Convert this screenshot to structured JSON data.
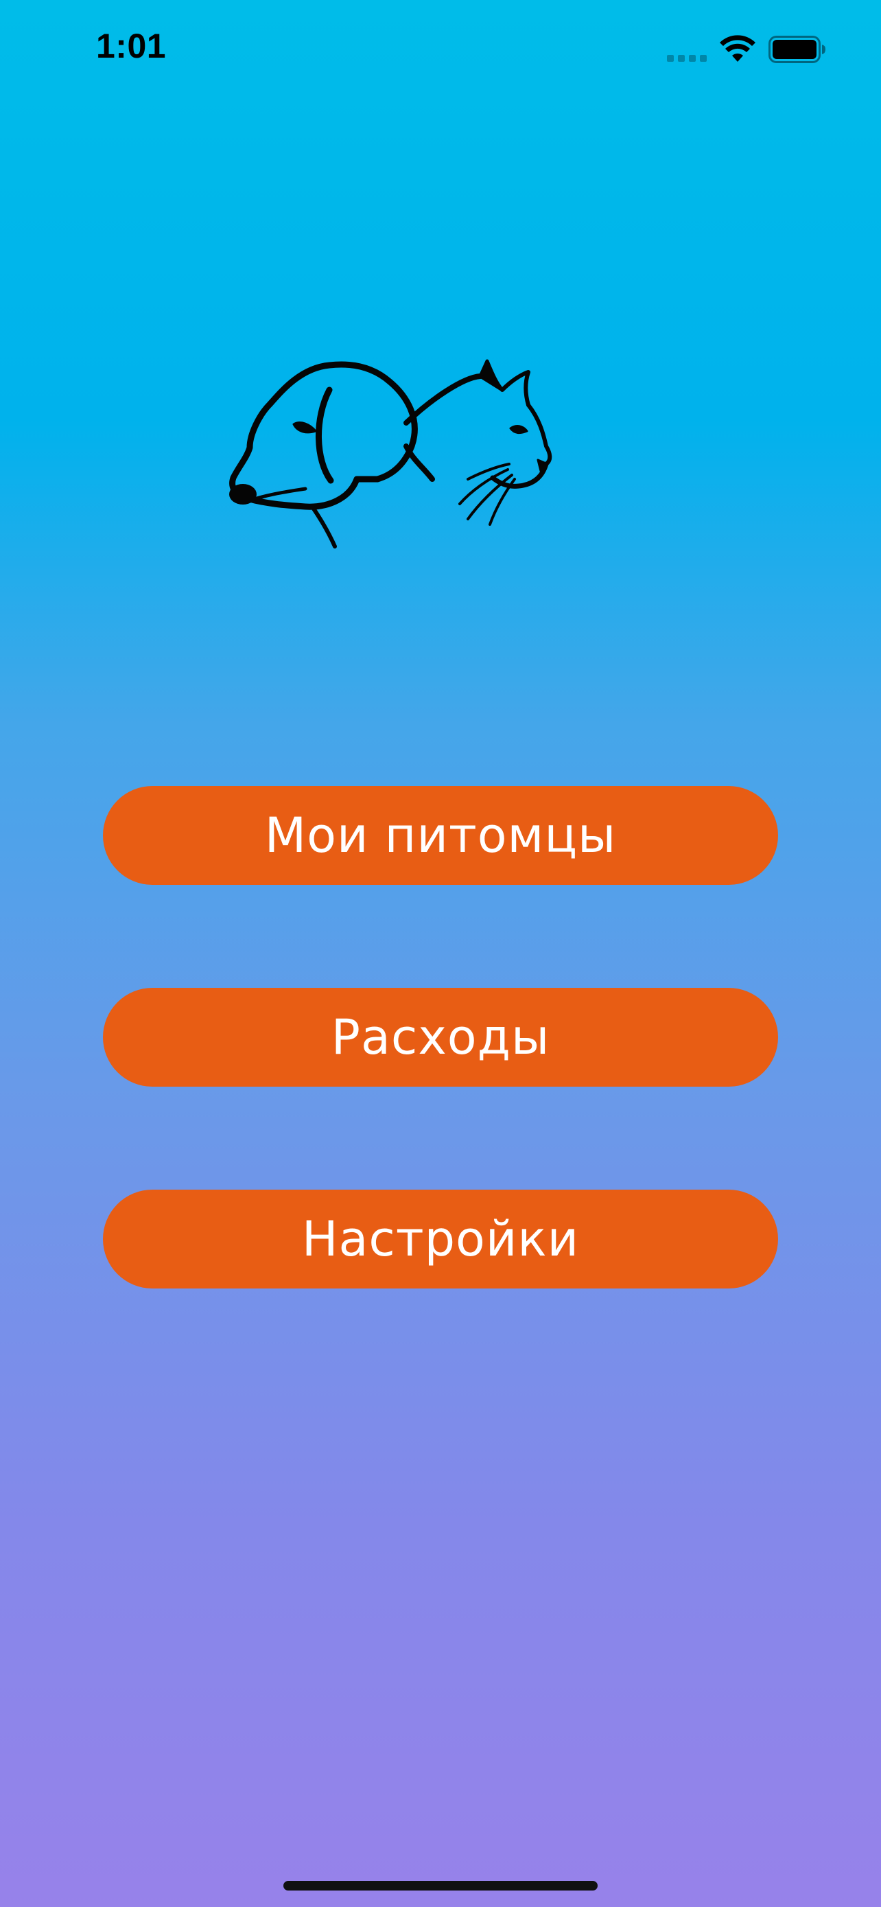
{
  "status_bar": {
    "time": "1:01",
    "icons": [
      "cellular-signal-icon",
      "wifi-icon",
      "battery-icon"
    ]
  },
  "logo": {
    "icon": "dog-and-cat-logo-icon"
  },
  "menu": {
    "buttons": [
      {
        "label": "Мои питомцы"
      },
      {
        "label": "Расходы"
      },
      {
        "label": "Настройки"
      }
    ]
  },
  "colors": {
    "button_background": "#E85D14",
    "button_text": "#FFFFFF",
    "gradient_top": "#00BCE9",
    "gradient_bottom": "#9782EA"
  }
}
